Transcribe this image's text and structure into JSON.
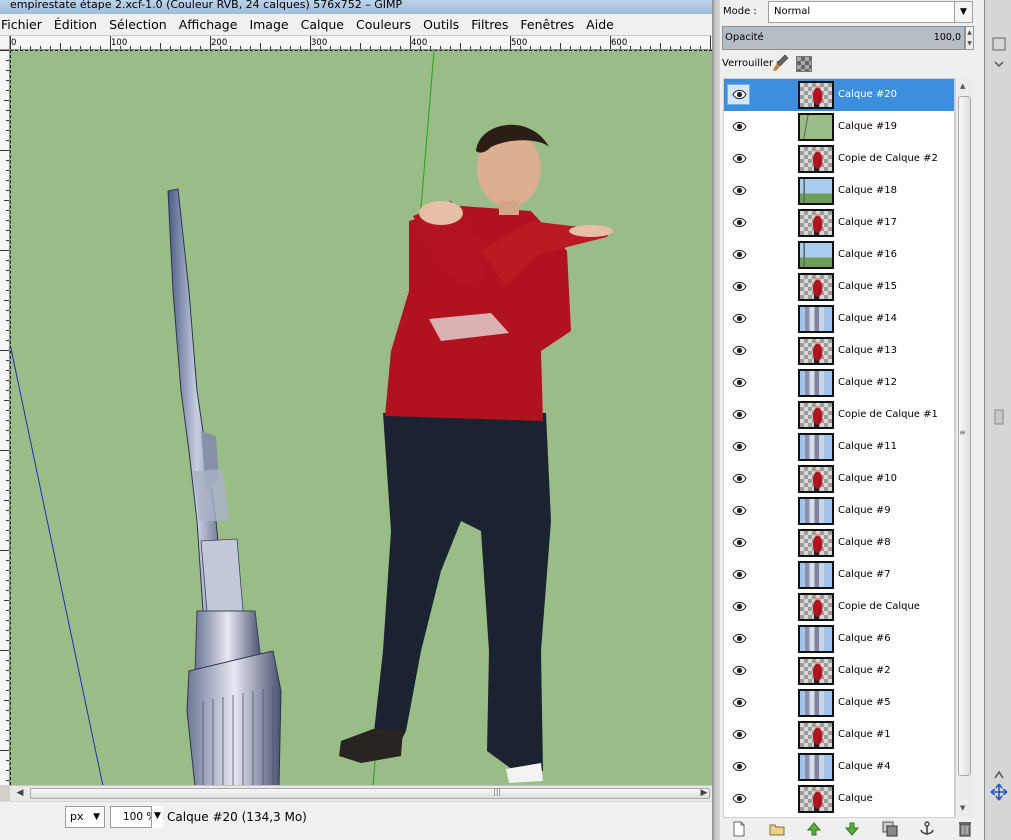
{
  "window": {
    "title": "empirestate étape 2.xcf-1.0 (Couleur RVB, 24 calques) 576x752 – GIMP"
  },
  "menubar": {
    "items": [
      "Fichier",
      "Édition",
      "Sélection",
      "Affichage",
      "Image",
      "Calque",
      "Couleurs",
      "Outils",
      "Filtres",
      "Fenêtres",
      "Aide"
    ]
  },
  "ruler": {
    "corner": "0",
    "labels": [
      "100",
      "200",
      "300",
      "400",
      "500",
      "600"
    ]
  },
  "statusbar": {
    "unit": "px",
    "zoom": "100 %",
    "info": "Calque #20 (134,3 Mo)"
  },
  "layers_dialog": {
    "mode_label": "Mode :",
    "mode_value": "Normal",
    "opacity_label": "Opacité",
    "opacity_value": "100,0",
    "lock_label": "Verrouiller :",
    "selected_index": 0,
    "layers": [
      {
        "name": "Calque #20",
        "thumb": "person"
      },
      {
        "name": "Calque #19",
        "thumb": "green"
      },
      {
        "name": "Copie de Calque #2",
        "thumb": "person"
      },
      {
        "name": "Calque #18",
        "thumb": "sky-spire"
      },
      {
        "name": "Calque #17",
        "thumb": "person"
      },
      {
        "name": "Calque #16",
        "thumb": "sky-spire"
      },
      {
        "name": "Calque #15",
        "thumb": "person"
      },
      {
        "name": "Calque #14",
        "thumb": "building"
      },
      {
        "name": "Calque #13",
        "thumb": "person"
      },
      {
        "name": "Calque #12",
        "thumb": "building"
      },
      {
        "name": "Copie de Calque #1",
        "thumb": "person"
      },
      {
        "name": "Calque #11",
        "thumb": "building"
      },
      {
        "name": "Calque #10",
        "thumb": "person"
      },
      {
        "name": "Calque #9",
        "thumb": "building"
      },
      {
        "name": "Calque #8",
        "thumb": "person"
      },
      {
        "name": "Calque #7",
        "thumb": "building"
      },
      {
        "name": "Copie de Calque",
        "thumb": "person"
      },
      {
        "name": "Calque #6",
        "thumb": "building"
      },
      {
        "name": "Calque #2",
        "thumb": "person"
      },
      {
        "name": "Calque #5",
        "thumb": "building"
      },
      {
        "name": "Calque #1",
        "thumb": "person"
      },
      {
        "name": "Calque #4",
        "thumb": "building"
      },
      {
        "name": "Calque",
        "thumb": "person"
      }
    ],
    "buttons": [
      "new-layer-icon",
      "new-layer-group-icon",
      "raise-layer-icon",
      "lower-layer-icon",
      "duplicate-layer-icon",
      "anchor-layer-icon",
      "delete-layer-icon"
    ]
  },
  "colors": {
    "canvas_bg": "#9abd88",
    "selection": "#3e8ede",
    "guide_green": "#1fa51f",
    "guide_blue": "#1b2eb8"
  }
}
